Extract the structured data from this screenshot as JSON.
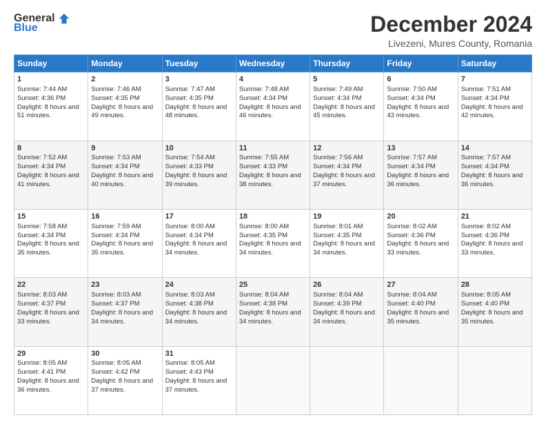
{
  "logo": {
    "general": "General",
    "blue": "Blue"
  },
  "header": {
    "title": "December 2024",
    "subtitle": "Livezeni, Mures County, Romania"
  },
  "weekdays": [
    "Sunday",
    "Monday",
    "Tuesday",
    "Wednesday",
    "Thursday",
    "Friday",
    "Saturday"
  ],
  "weeks": [
    [
      {
        "day": "1",
        "sunrise": "7:44 AM",
        "sunset": "4:36 PM",
        "daylight": "8 hours and 51 minutes."
      },
      {
        "day": "2",
        "sunrise": "7:46 AM",
        "sunset": "4:35 PM",
        "daylight": "8 hours and 49 minutes."
      },
      {
        "day": "3",
        "sunrise": "7:47 AM",
        "sunset": "4:35 PM",
        "daylight": "8 hours and 48 minutes."
      },
      {
        "day": "4",
        "sunrise": "7:48 AM",
        "sunset": "4:34 PM",
        "daylight": "8 hours and 46 minutes."
      },
      {
        "day": "5",
        "sunrise": "7:49 AM",
        "sunset": "4:34 PM",
        "daylight": "8 hours and 45 minutes."
      },
      {
        "day": "6",
        "sunrise": "7:50 AM",
        "sunset": "4:34 PM",
        "daylight": "8 hours and 43 minutes."
      },
      {
        "day": "7",
        "sunrise": "7:51 AM",
        "sunset": "4:34 PM",
        "daylight": "8 hours and 42 minutes."
      }
    ],
    [
      {
        "day": "8",
        "sunrise": "7:52 AM",
        "sunset": "4:34 PM",
        "daylight": "8 hours and 41 minutes."
      },
      {
        "day": "9",
        "sunrise": "7:53 AM",
        "sunset": "4:34 PM",
        "daylight": "8 hours and 40 minutes."
      },
      {
        "day": "10",
        "sunrise": "7:54 AM",
        "sunset": "4:33 PM",
        "daylight": "8 hours and 39 minutes."
      },
      {
        "day": "11",
        "sunrise": "7:55 AM",
        "sunset": "4:33 PM",
        "daylight": "8 hours and 38 minutes."
      },
      {
        "day": "12",
        "sunrise": "7:56 AM",
        "sunset": "4:34 PM",
        "daylight": "8 hours and 37 minutes."
      },
      {
        "day": "13",
        "sunrise": "7:57 AM",
        "sunset": "4:34 PM",
        "daylight": "8 hours and 36 minutes."
      },
      {
        "day": "14",
        "sunrise": "7:57 AM",
        "sunset": "4:34 PM",
        "daylight": "8 hours and 36 minutes."
      }
    ],
    [
      {
        "day": "15",
        "sunrise": "7:58 AM",
        "sunset": "4:34 PM",
        "daylight": "8 hours and 35 minutes."
      },
      {
        "day": "16",
        "sunrise": "7:59 AM",
        "sunset": "4:34 PM",
        "daylight": "8 hours and 35 minutes."
      },
      {
        "day": "17",
        "sunrise": "8:00 AM",
        "sunset": "4:34 PM",
        "daylight": "8 hours and 34 minutes."
      },
      {
        "day": "18",
        "sunrise": "8:00 AM",
        "sunset": "4:35 PM",
        "daylight": "8 hours and 34 minutes."
      },
      {
        "day": "19",
        "sunrise": "8:01 AM",
        "sunset": "4:35 PM",
        "daylight": "8 hours and 34 minutes."
      },
      {
        "day": "20",
        "sunrise": "8:02 AM",
        "sunset": "4:36 PM",
        "daylight": "8 hours and 33 minutes."
      },
      {
        "day": "21",
        "sunrise": "8:02 AM",
        "sunset": "4:36 PM",
        "daylight": "8 hours and 33 minutes."
      }
    ],
    [
      {
        "day": "22",
        "sunrise": "8:03 AM",
        "sunset": "4:37 PM",
        "daylight": "8 hours and 33 minutes."
      },
      {
        "day": "23",
        "sunrise": "8:03 AM",
        "sunset": "4:37 PM",
        "daylight": "8 hours and 34 minutes."
      },
      {
        "day": "24",
        "sunrise": "8:03 AM",
        "sunset": "4:38 PM",
        "daylight": "8 hours and 34 minutes."
      },
      {
        "day": "25",
        "sunrise": "8:04 AM",
        "sunset": "4:38 PM",
        "daylight": "8 hours and 34 minutes."
      },
      {
        "day": "26",
        "sunrise": "8:04 AM",
        "sunset": "4:39 PM",
        "daylight": "8 hours and 34 minutes."
      },
      {
        "day": "27",
        "sunrise": "8:04 AM",
        "sunset": "4:40 PM",
        "daylight": "8 hours and 35 minutes."
      },
      {
        "day": "28",
        "sunrise": "8:05 AM",
        "sunset": "4:40 PM",
        "daylight": "8 hours and 35 minutes."
      }
    ],
    [
      {
        "day": "29",
        "sunrise": "8:05 AM",
        "sunset": "4:41 PM",
        "daylight": "8 hours and 36 minutes."
      },
      {
        "day": "30",
        "sunrise": "8:05 AM",
        "sunset": "4:42 PM",
        "daylight": "8 hours and 37 minutes."
      },
      {
        "day": "31",
        "sunrise": "8:05 AM",
        "sunset": "4:43 PM",
        "daylight": "8 hours and 37 minutes."
      },
      null,
      null,
      null,
      null
    ]
  ],
  "labels": {
    "sunrise": "Sunrise:",
    "sunset": "Sunset:",
    "daylight": "Daylight:"
  }
}
